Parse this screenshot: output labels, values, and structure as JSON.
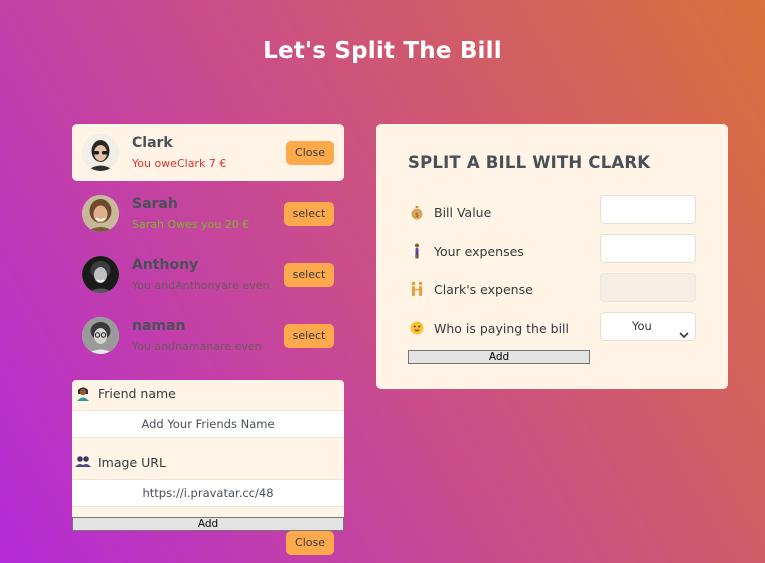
{
  "title": "Let's Split The Bill",
  "friends": [
    {
      "name": "Clark",
      "status": "You oweClark 7 €",
      "button": "Close",
      "selected": true
    },
    {
      "name": "Sarah",
      "status": "Sarah Owes you 20 €",
      "button": "select",
      "selected": false
    },
    {
      "name": "Anthony",
      "status": "You andAnthonyare even",
      "button": "select",
      "selected": false
    },
    {
      "name": "naman",
      "status": "You andnamanare even",
      "button": "select",
      "selected": false
    }
  ],
  "add_friend": {
    "name_label": "Friend name",
    "name_placeholder": "Add Your Friends Name",
    "image_label": "Image URL",
    "image_value": "https://i.pravatar.cc/48",
    "add_button": "Add",
    "close_button": "Close",
    "icons": [
      "person-icon",
      "people-icon"
    ]
  },
  "split_form": {
    "title": "SPLIT A BILL WITH CLARK",
    "bill_value_label": "Bill Value",
    "your_expenses_label": "Your expenses",
    "friend_expense_label": "Clark's expense",
    "payer_label": "Who is paying the bill",
    "payer_selected": "You",
    "add_button": "Add",
    "icons": [
      "money-bag-icon",
      "person-standing-icon",
      "people-holding-hands-icon",
      "smiley-icon"
    ]
  },
  "colors": {
    "button_orange": "#ffa94d",
    "panel_bg": "#fff4e6",
    "owe_red": "#e03131",
    "owed_green": "#7bb52a",
    "title_white": "#ffffff"
  }
}
